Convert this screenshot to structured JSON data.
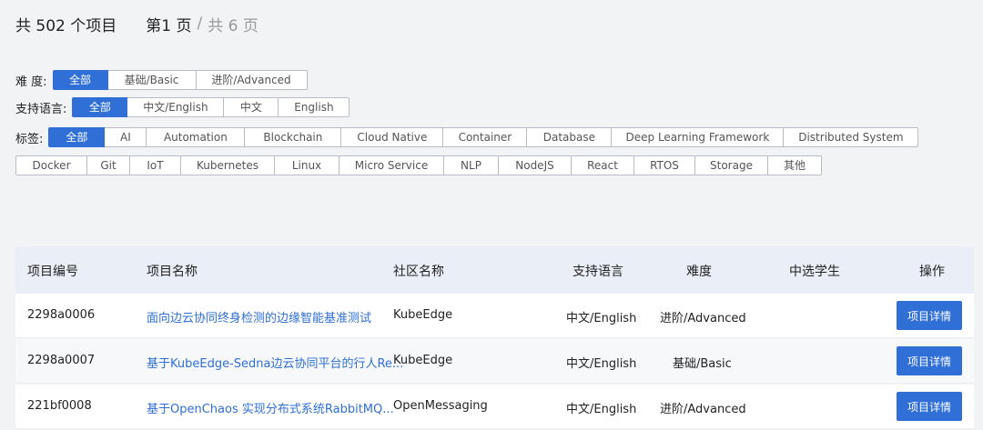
{
  "summary": {
    "total": "共 502 个项目",
    "current_page": "第1 页",
    "separator": "/",
    "total_pages": "共 6 页"
  },
  "filters": {
    "difficulty": {
      "label": "难 度:",
      "options": [
        "全部",
        "基础/Basic",
        "进阶/Advanced"
      ],
      "active": "全部"
    },
    "language": {
      "label": "支持语言:",
      "options": [
        "全部",
        "中文/English",
        "中文",
        "English"
      ],
      "active": "全部"
    },
    "tags": {
      "label": "标签:",
      "row1": [
        "全部",
        "AI",
        "Automation",
        "Blockchain",
        "Cloud Native",
        "Container",
        "Database",
        "Deep Learning Framework",
        "Distributed System"
      ],
      "row2": [
        "Docker",
        "Git",
        "IoT",
        "Kubernetes",
        "Linux",
        "Micro Service",
        "NLP",
        "NodeJS",
        "React",
        "RTOS",
        "Storage",
        "其他"
      ],
      "active": "全部"
    }
  },
  "table": {
    "headers": {
      "id": "项目编号",
      "name": "项目名称",
      "community": "社区名称",
      "language": "支持语言",
      "difficulty": "难度",
      "student": "中选学生",
      "operation": "操作"
    },
    "rows": [
      {
        "id": "2298a0006",
        "name": "面向边云协同终身检测的边缘智能基准测试",
        "community": "KubeEdge",
        "language": "中文/English",
        "difficulty": "进阶/Advanced",
        "student": "",
        "action": "项目详情"
      },
      {
        "id": "2298a0007",
        "name": "基于KubeEdge-Sedna边云协同平台的行人Re...",
        "community": "KubeEdge",
        "language": "中文/English",
        "difficulty": "基础/Basic",
        "student": "",
        "action": "项目详情"
      },
      {
        "id": "221bf0008",
        "name": "基于OpenChaos 实现分布式系统RabbitMQ...",
        "community": "OpenMessaging",
        "language": "中文/English",
        "difficulty": "进阶/Advanced",
        "student": "",
        "action": "项目详情"
      }
    ]
  },
  "colors": {
    "accent": "#2f6fd6",
    "background": "#f2f3f5",
    "header_bg": "#eaeef6"
  }
}
